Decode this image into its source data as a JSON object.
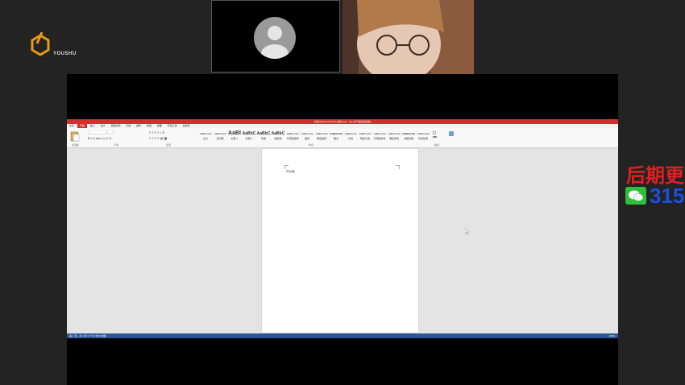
{
  "logo": {
    "text": "YOUSHU"
  },
  "cameras": {
    "left": {
      "state": "no video"
    },
    "right": {
      "state": "participant video"
    }
  },
  "word": {
    "title": "文档 Microsoft Word 文档.docx - Word(产品激活失败)",
    "tabs": [
      "文件",
      "开始",
      "插入",
      "设计",
      "页面布局",
      "引用",
      "邮件",
      "审阅",
      "视图",
      "开发工具",
      "加载项"
    ],
    "active_tab": "开始",
    "styles": [
      "AaBbCcDd",
      "AaBbCcDd",
      "AaBl",
      "AaBbC",
      "AaBbC",
      "AaBbC",
      "AaBbCcDd",
      "AaBbCcDd",
      "AaBbCcDd",
      "AaBbCcDd",
      "AaBbCcDd",
      "AaBbCcDd",
      "AaBbCcDd",
      "AaBbCcDd",
      "AaBbCcDd",
      "AaBbCcDd"
    ],
    "style_names": [
      "正文",
      "无间隔",
      "标题 1",
      "标题 2",
      "标题",
      "副标题",
      "不明显强调",
      "强调",
      "明显强调",
      "要点",
      "引用",
      "明显引用",
      "不明显参考",
      "明显参考",
      "书籍标题",
      "列出段落"
    ],
    "group_labels": [
      "剪贴板",
      "字体",
      "段落",
      "样式",
      "编辑"
    ],
    "page_text": "项目编",
    "status_left": "第 1 页，共 1 页   3 个字   中文(中国)",
    "status_right": "100%"
  },
  "promo": {
    "line1": "后期更",
    "line2": "315"
  },
  "colors": {
    "word_red": "#d32f2f",
    "status_blue": "#2b5797",
    "promo_red": "#e02020",
    "promo_blue": "#1a4fe0",
    "wechat_green": "#2fbf3b"
  }
}
